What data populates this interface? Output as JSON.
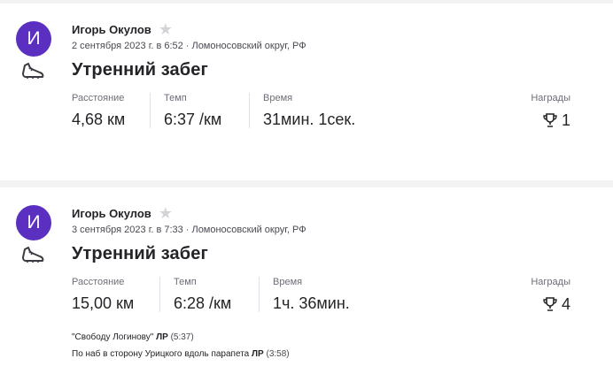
{
  "activities": [
    {
      "avatar_letter": "И",
      "athlete": "Игорь Окулов",
      "date": "2 сентября 2023 г. в 6:52",
      "location": "Ломоносовский округ, РФ",
      "meta_separator": "·",
      "title": "Утренний забег",
      "stats": [
        {
          "label": "Расстояние",
          "value": "4,68 км"
        },
        {
          "label": "Темп",
          "value": "6:37 /км"
        },
        {
          "label": "Время",
          "value": "31мин. 1сек."
        }
      ],
      "awards_label": "Награды",
      "awards_count": "1"
    },
    {
      "avatar_letter": "И",
      "athlete": "Игорь Окулов",
      "date": "3 сентября 2023 г. в 7:33",
      "location": "Ломоносовский округ, РФ",
      "meta_separator": "·",
      "title": "Утренний забег",
      "stats": [
        {
          "label": "Расстояние",
          "value": "15,00 км"
        },
        {
          "label": "Темп",
          "value": "6:28 /км"
        },
        {
          "label": "Время",
          "value": "1ч. 36мин."
        }
      ],
      "awards_label": "Награды",
      "awards_count": "4",
      "segments": [
        {
          "name": "\"Свободу Логинову\"",
          "badge": "ЛР",
          "time": "(5:37)"
        },
        {
          "name": "По наб в сторону Урицкого вдоль парапета",
          "badge": "ЛР",
          "time": "(3:58)"
        }
      ]
    }
  ],
  "colors": {
    "avatar": "#5b2fbf",
    "text": "#242428",
    "muted": "#6d6d78",
    "star": "#d4d4d8"
  },
  "icons": {
    "sport": "running-shoe-icon",
    "favorite": "star-icon",
    "awards": "trophy-icon"
  }
}
